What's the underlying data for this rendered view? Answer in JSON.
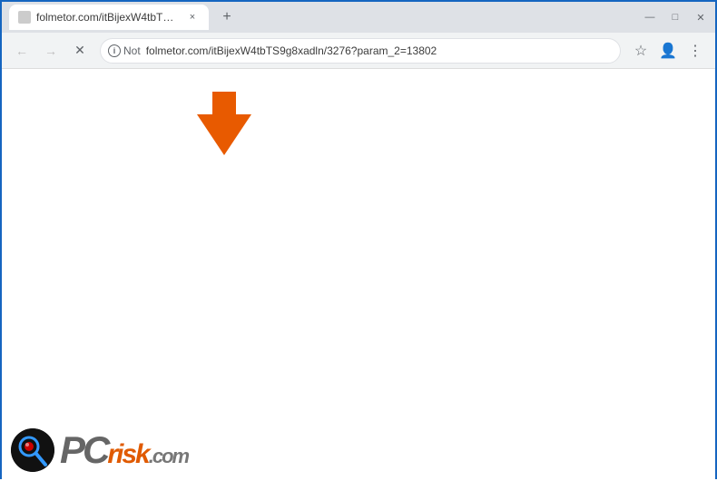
{
  "title_bar": {
    "tab": {
      "title": "folmetor.com/itBijexW4tbTS9g8...",
      "close_label": "×"
    },
    "new_tab_label": "+",
    "window_controls": {
      "minimize": "—",
      "maximize": "□",
      "close": "✕"
    }
  },
  "toolbar": {
    "back_label": "←",
    "forward_label": "→",
    "reload_label": "✕",
    "security_status": "Not",
    "url": "folmetor.com/itBijexW4tbTS9g8xadln/3276?param_2=13802",
    "full_url": "folmetor.com/itBijexW4tbTS9g8xadln/3276?param_2=13802"
  },
  "watermark": {
    "pc_text": "PC",
    "risk_text": "risk",
    "dot_com": ".com"
  },
  "arrow": {
    "color": "#E85A00"
  }
}
